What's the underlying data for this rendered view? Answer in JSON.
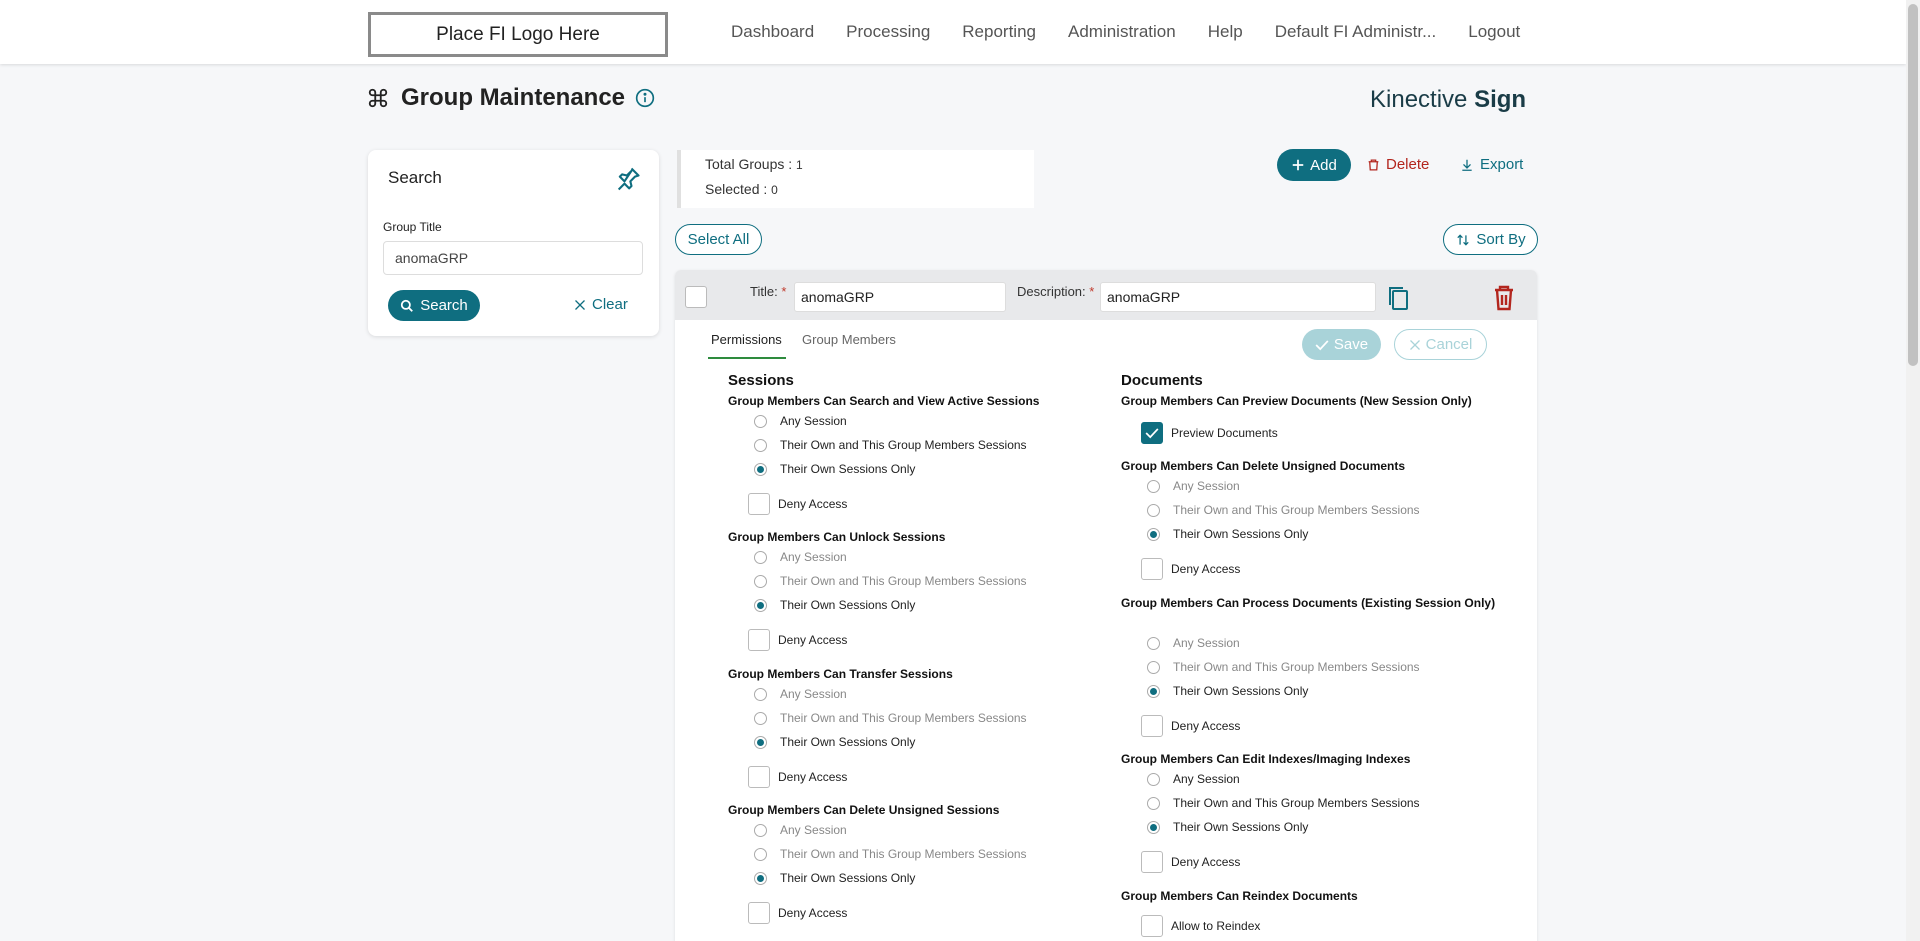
{
  "header": {
    "logo_text": "Place FI Logo Here",
    "nav": [
      "Dashboard",
      "Processing",
      "Reporting",
      "Administration",
      "Help",
      "Default FI Administr...",
      "Logout"
    ]
  },
  "page": {
    "title": "Group Maintenance",
    "brand_light": "Kinective ",
    "brand_bold": "Sign"
  },
  "search": {
    "title": "Search",
    "field_label": "Group Title",
    "field_value": "anomaGRP",
    "search_label": "Search",
    "clear_label": "Clear"
  },
  "stats": {
    "total_label": "Total Groups : ",
    "total_value": "1",
    "selected_label": "Selected : ",
    "selected_value": "0"
  },
  "toolbar": {
    "add": "Add",
    "delete": "Delete",
    "export": "Export",
    "select_all": "Select All",
    "sort_by": "Sort By"
  },
  "group": {
    "title_label": "Title:",
    "title_value": "anomaGRP",
    "desc_label": "Description:",
    "desc_value": "anomaGRP",
    "required_mark": "*"
  },
  "tabs": {
    "permissions": "Permissions",
    "members": "Group Members",
    "save": "Save",
    "cancel": "Cancel"
  },
  "options": {
    "any": "Any Session",
    "own_group": "Their Own and This Group Members Sessions",
    "own_only": "Their Own Sessions Only",
    "deny": "Deny Access"
  },
  "sessions": {
    "title": "Sessions",
    "perms": [
      "Group Members Can Search and View Active Sessions",
      "Group Members Can Unlock Sessions",
      "Group Members Can Transfer Sessions",
      "Group Members Can Delete Unsigned Sessions"
    ]
  },
  "documents": {
    "title": "Documents",
    "preview_title": "Group Members Can Preview Documents (New Session Only)",
    "preview_label": "Preview Documents",
    "perms": [
      "Group Members Can Delete Unsigned Documents",
      "Group Members Can Process Documents (Existing Session Only)",
      "Group Members Can Edit Indexes/Imaging Indexes"
    ],
    "reindex_title": "Group Members Can Reindex Documents",
    "reindex_label": "Allow to Reindex"
  },
  "colors": {
    "primary": "#0f6e80",
    "danger": "#b3261e",
    "tab_underline": "#2e8b3e"
  }
}
